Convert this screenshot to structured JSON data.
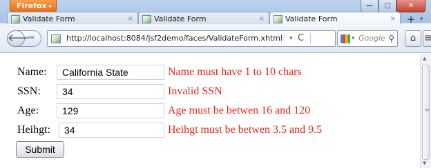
{
  "browser": {
    "menu_label": "Firefox",
    "menu_arrow": "▾",
    "window_controls": {
      "minimize": "—",
      "maximize": "□",
      "close": "✕"
    },
    "tabs": [
      {
        "title": "Validate Form",
        "close": "×"
      },
      {
        "title": "Validate Form",
        "close": "×"
      },
      {
        "title": "Validate Form",
        "close": "×"
      }
    ],
    "new_tab_label": "+",
    "tab_list_arrow": "▾",
    "back_glyph": "🡐",
    "forward_glyph": "➡",
    "url": "http://localhost:8084/jsf2demo/faces/ValidateForm.xhtml",
    "star_glyph": "☆",
    "url_dropdown": "▾",
    "reload_glyph": "C",
    "search_dropdown": "▾",
    "search_placeholder": "Google",
    "search_glyph": "⚲",
    "home_glyph": "⌂",
    "bookmark_glyph": "▤",
    "scroll_up": "▲",
    "scroll_down": "▼",
    "scroll_grip": "≡"
  },
  "form": {
    "rows": [
      {
        "label": "Name:",
        "value": "California State",
        "error": "Name must have 1 to 10 chars"
      },
      {
        "label": "SSN:",
        "value": "34",
        "error": "Invalid SSN"
      },
      {
        "label": "Age:",
        "value": "129",
        "error": "Age must be betwen 16 and 120"
      },
      {
        "label": "Heihgt:",
        "value": "34",
        "error": "Heihgt must be betwen 3.5 and 9.5"
      }
    ],
    "submit_label": "Submit"
  },
  "colors": {
    "error_text": "#e8221a",
    "firefox_button": "#e86d13",
    "titlebar": "#bcd3ee"
  }
}
